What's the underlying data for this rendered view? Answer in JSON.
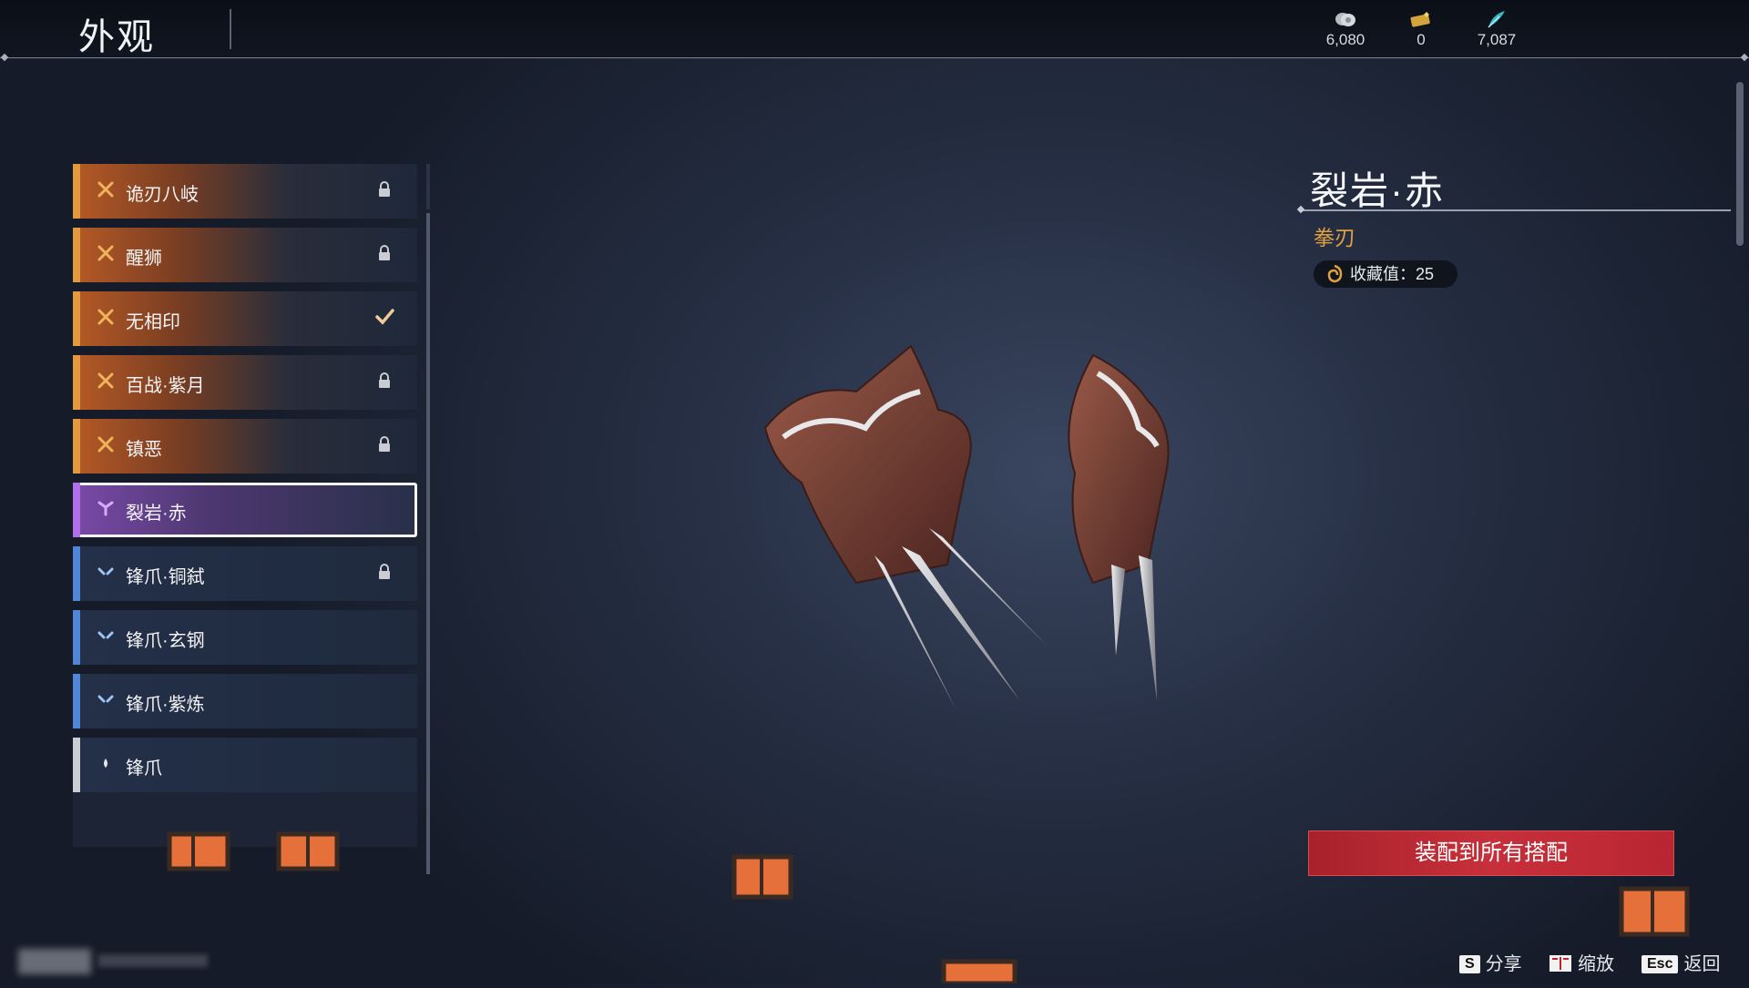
{
  "header": {
    "title": "外观",
    "currencies": [
      {
        "icon": "coin-stack-icon",
        "value": "6,080"
      },
      {
        "icon": "ticket-icon",
        "value": "0"
      },
      {
        "icon": "feather-icon",
        "value": "7,087"
      }
    ]
  },
  "skin_list": {
    "items": [
      {
        "rarity": "gold",
        "name": "诡刃八岐",
        "state": "locked"
      },
      {
        "rarity": "gold",
        "name": "醒狮",
        "state": "locked"
      },
      {
        "rarity": "gold",
        "name": "无相印",
        "state": "equipped"
      },
      {
        "rarity": "gold",
        "name": "百战·紫月",
        "state": "locked"
      },
      {
        "rarity": "gold",
        "name": "镇恶",
        "state": "locked"
      },
      {
        "rarity": "purple",
        "name": "裂岩·赤",
        "state": "selected"
      },
      {
        "rarity": "blue",
        "name": "锋爪·铜弑",
        "state": "locked"
      },
      {
        "rarity": "blue",
        "name": "锋爪·玄钢",
        "state": "none"
      },
      {
        "rarity": "blue",
        "name": "锋爪·紫炼",
        "state": "none"
      },
      {
        "rarity": "white",
        "name": "锋爪",
        "state": "none"
      }
    ]
  },
  "detail": {
    "name": "裂岩·赤",
    "type": "拳刃",
    "collection_label": "收藏值：25"
  },
  "actions": {
    "equip_all_label": "装配到所有搭配"
  },
  "hints": [
    {
      "key": "S",
      "label": "分享"
    },
    {
      "key": "book-icon",
      "label": "缩放"
    },
    {
      "key": "Esc",
      "label": "返回"
    }
  ],
  "colors": {
    "gold": "#e39a3e",
    "purple": "#b070ea",
    "blue": "#4f86d6",
    "accent_red": "#c7303a",
    "type_text": "#e0a040"
  }
}
